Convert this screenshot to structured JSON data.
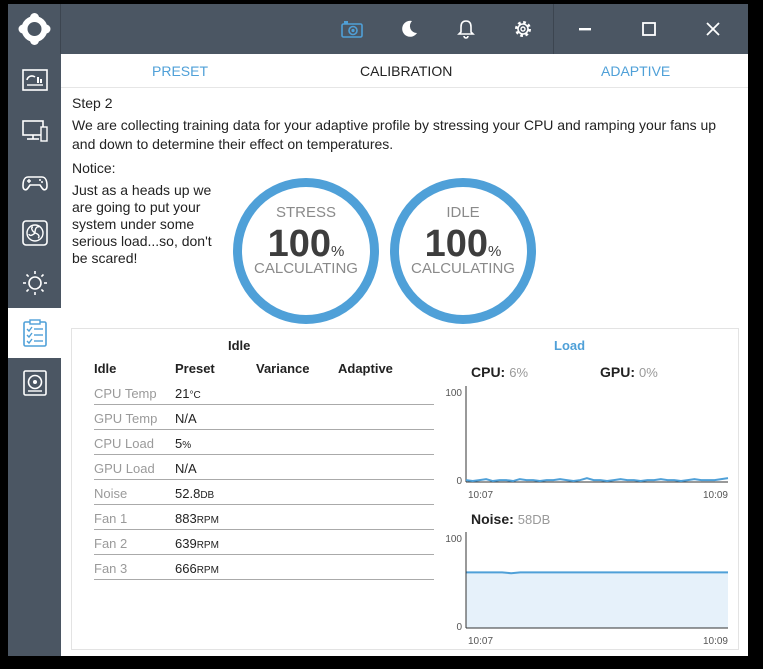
{
  "tabs": [
    {
      "label": "PRESET"
    },
    {
      "label": "CALIBRATION"
    },
    {
      "label": "ADAPTIVE"
    }
  ],
  "step": {
    "title": "Step 2",
    "description": "We are collecting training data for your adaptive profile by stressing your CPU and ramping your fans up and down to determine their effect on temperatures."
  },
  "notice": {
    "title": "Notice:",
    "text": "Just as a heads up we are going to put your system under some serious load...so, don't be scared!"
  },
  "rings": {
    "stress": {
      "label": "STRESS",
      "value": "100",
      "unit": "%",
      "status": "CALCULATING"
    },
    "idle": {
      "label": "IDLE",
      "value": "100",
      "unit": "%",
      "status": "CALCULATING"
    }
  },
  "panel": {
    "left_title": "Idle",
    "right_title": "Load",
    "columns": [
      "Idle",
      "Preset",
      "Variance",
      "Adaptive"
    ],
    "rows": [
      {
        "label": "CPU Temp",
        "value": "21",
        "unit": "°C"
      },
      {
        "label": "GPU Temp",
        "value": "N/A",
        "unit": ""
      },
      {
        "label": "CPU Load",
        "value": "5",
        "unit": "%"
      },
      {
        "label": "GPU Load",
        "value": "N/A",
        "unit": ""
      },
      {
        "label": "Noise",
        "value": "52.8",
        "unit": "DB"
      },
      {
        "label": "Fan 1",
        "value": "883",
        "unit": "RPM"
      },
      {
        "label": "Fan 2",
        "value": "639",
        "unit": "RPM"
      },
      {
        "label": "Fan 3",
        "value": "666",
        "unit": "RPM"
      }
    ]
  },
  "load_chart": {
    "cpu_label": "CPU:",
    "cpu_value": "6%",
    "gpu_label": "GPU:",
    "gpu_value": "0%"
  },
  "noise_chart": {
    "label": "Noise:",
    "value": "58DB"
  },
  "chart_data": [
    {
      "type": "line",
      "ylim": [
        0,
        100
      ],
      "y_ticks": [
        "100",
        "0"
      ],
      "x_ticks": [
        "10:07",
        "10:09"
      ],
      "series": [
        {
          "name": "CPU",
          "values": [
            2,
            1,
            2,
            3,
            1,
            2,
            2,
            1,
            3,
            2,
            2,
            1,
            2,
            2,
            3,
            2,
            1,
            2,
            4,
            2,
            2,
            1,
            2,
            3,
            2,
            2,
            1,
            2,
            2,
            3,
            2,
            2,
            1,
            2,
            3,
            2,
            2,
            2,
            3,
            4
          ]
        }
      ]
    },
    {
      "type": "area",
      "ylim": [
        0,
        100
      ],
      "y_ticks": [
        "100",
        "0"
      ],
      "x_ticks": [
        "10:07",
        "10:09"
      ],
      "series": [
        {
          "name": "Noise",
          "values": [
            58,
            58,
            58,
            58,
            58,
            57,
            58,
            58,
            58,
            58,
            58,
            58,
            58,
            58,
            58,
            58,
            58,
            58,
            58,
            58,
            58,
            58,
            58,
            58,
            58,
            58,
            58,
            58,
            58,
            58
          ]
        }
      ]
    }
  ],
  "colors": {
    "accent": "#4fa0d8",
    "chrome": "#4b5663",
    "area_fill": "#e6f1fa"
  },
  "icons": {
    "titlebar": [
      "camera-icon",
      "moon-icon",
      "bell-icon",
      "gear-icon",
      "minimize-icon",
      "maximize-icon",
      "close-icon"
    ],
    "sidebar": [
      "dashboard-icon",
      "monitor-icon",
      "gamepad-icon",
      "fan-icon",
      "brightness-icon",
      "checklist-icon",
      "disk-icon"
    ]
  }
}
